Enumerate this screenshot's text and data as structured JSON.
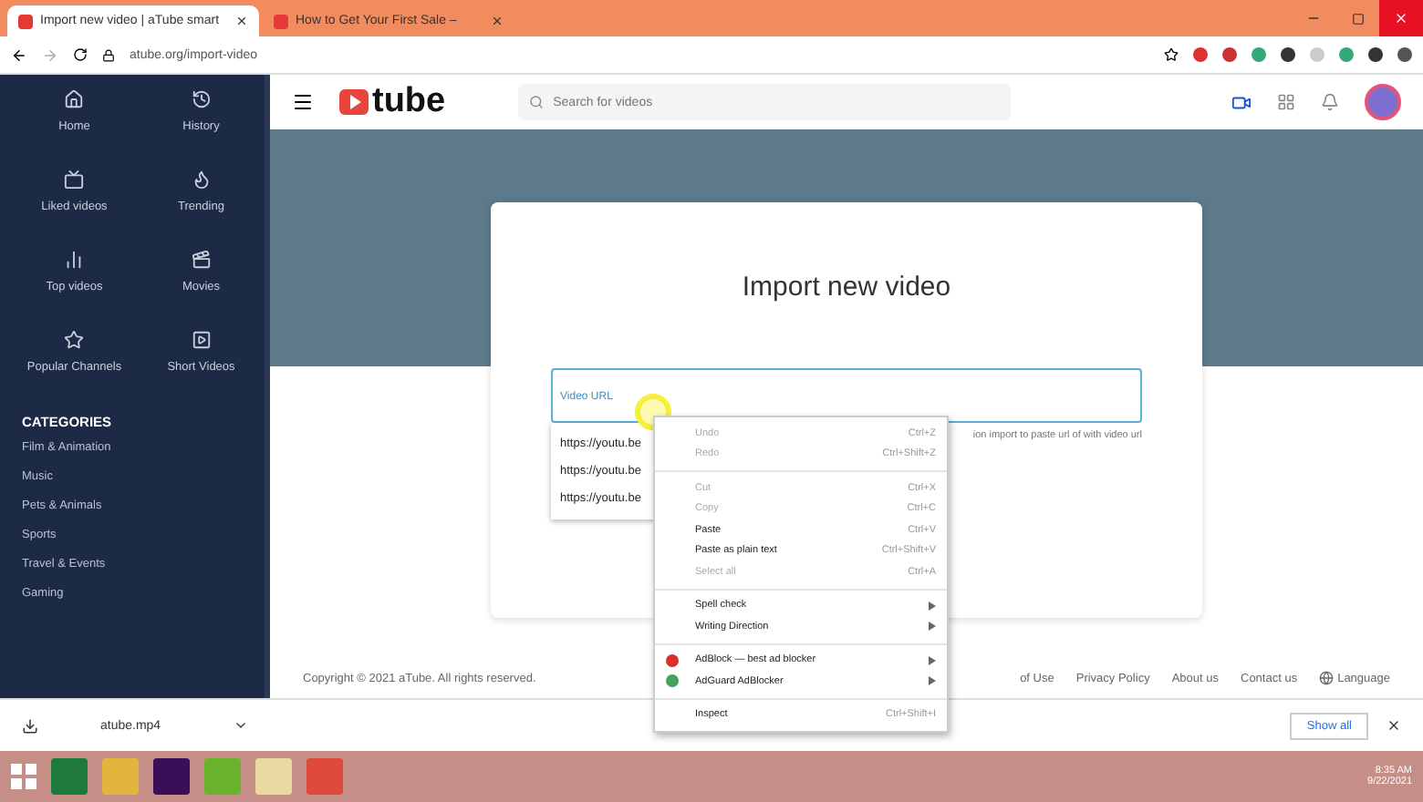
{
  "browser": {
    "tabs": [
      {
        "title": "Import new video | aTube smart",
        "selected": true
      },
      {
        "title": "How to Get Your First Sale –",
        "selected": false
      }
    ],
    "url": "atube.org/import-video"
  },
  "header": {
    "logo": "tube",
    "search_placeholder": "Search for videos"
  },
  "sidebar": {
    "nav": [
      "Home",
      "History",
      "Liked videos",
      "Trending",
      "Top videos",
      "Movies",
      "Popular Channels",
      "Short Videos"
    ],
    "categories_title": "CATEGORIES",
    "categories": [
      "Film & Animation",
      "Music",
      "Pets & Animals",
      "Sports",
      "Travel & Events",
      "Gaming"
    ]
  },
  "import_card": {
    "title": "Import new video",
    "field_label": "Video URL",
    "helper": "ion import to paste url of with video url",
    "suggestions": [
      "https://youtu.be",
      "https://youtu.be",
      "https://youtu.be"
    ]
  },
  "context_menu": {
    "groups": [
      [
        {
          "label": "Undo",
          "shortcut": "Ctrl+Z",
          "disabled": true,
          "submenu": false
        },
        {
          "label": "Redo",
          "shortcut": "Ctrl+Shift+Z",
          "disabled": true,
          "submenu": false
        }
      ],
      [
        {
          "label": "Cut",
          "shortcut": "Ctrl+X",
          "disabled": true,
          "submenu": false
        },
        {
          "label": "Copy",
          "shortcut": "Ctrl+C",
          "disabled": true,
          "submenu": false
        },
        {
          "label": "Paste",
          "shortcut": "Ctrl+V",
          "disabled": false,
          "submenu": false
        },
        {
          "label": "Paste as plain text",
          "shortcut": "Ctrl+Shift+V",
          "disabled": false,
          "submenu": false
        },
        {
          "label": "Select all",
          "shortcut": "Ctrl+A",
          "disabled": true,
          "submenu": false
        }
      ],
      [
        {
          "label": "Spell check",
          "disabled": false,
          "submenu": true
        },
        {
          "label": "Writing Direction",
          "disabled": false,
          "submenu": true
        }
      ],
      [
        {
          "label": "AdBlock — best ad blocker",
          "disabled": false,
          "submenu": true,
          "color": "#d9302c"
        },
        {
          "label": "AdGuard AdBlocker",
          "disabled": false,
          "submenu": true,
          "color": "#43a35a"
        }
      ],
      [
        {
          "label": "Inspect",
          "shortcut": "Ctrl+Shift+I",
          "disabled": false,
          "submenu": false
        }
      ]
    ]
  },
  "footer": {
    "copyright": "Copyright © 2021 aTube. All rights reserved.",
    "links": [
      "of Use",
      "Privacy Policy",
      "About us",
      "Contact us"
    ],
    "language": "Language"
  },
  "download_bar": {
    "file": "atube.mp4",
    "show_all": "Show all"
  },
  "taskbar": {
    "time": "8:35 AM",
    "date": "9/22/2021"
  }
}
